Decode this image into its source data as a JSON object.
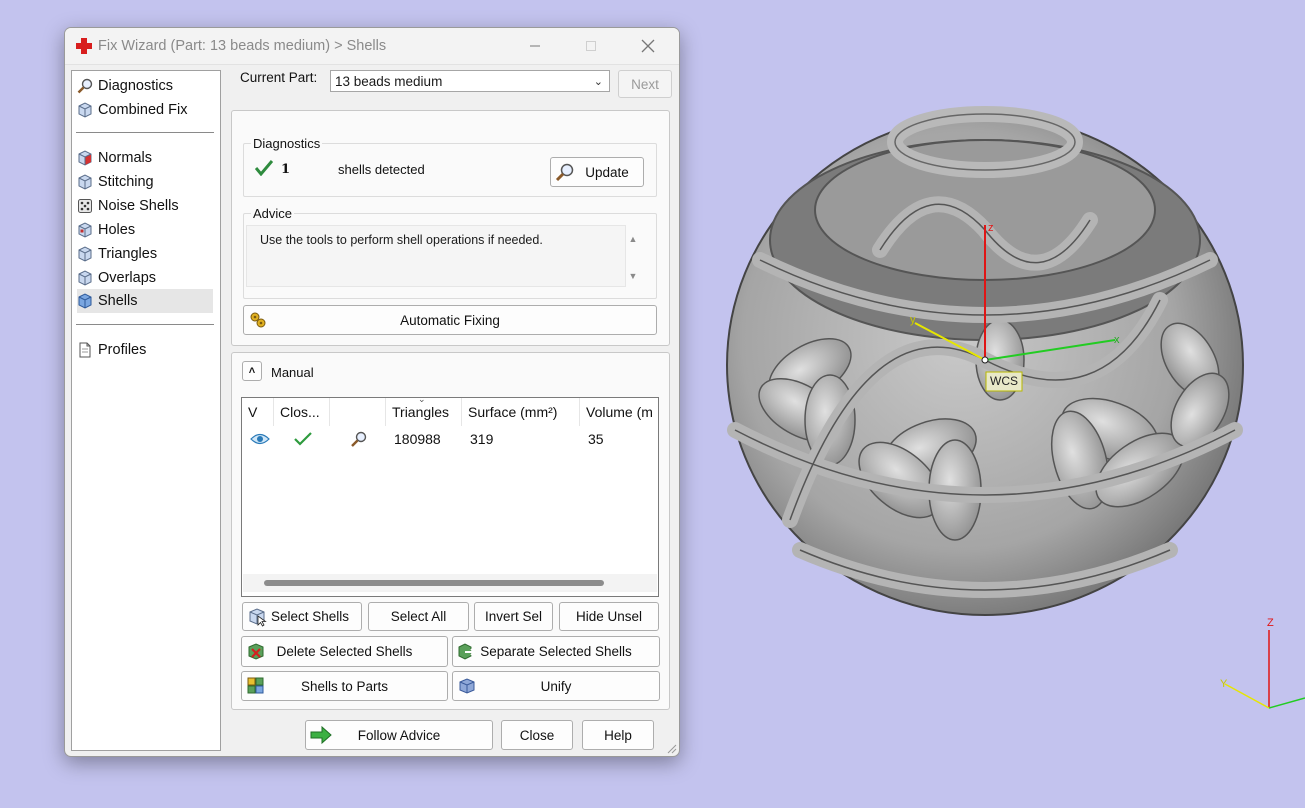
{
  "window": {
    "title": "Fix Wizard (Part: 13 beads medium) > Shells"
  },
  "nav": {
    "items": [
      {
        "label": "Diagnostics",
        "icon": "magnifier-icon"
      },
      {
        "label": "Combined Fix",
        "icon": "cube-icon"
      },
      {
        "label": "Normals",
        "icon": "cube-red-icon"
      },
      {
        "label": "Stitching",
        "icon": "cube-icon"
      },
      {
        "label": "Noise Shells",
        "icon": "dice-icon"
      },
      {
        "label": "Holes",
        "icon": "cube-icon"
      },
      {
        "label": "Triangles",
        "icon": "cube-icon"
      },
      {
        "label": "Overlaps",
        "icon": "cube-icon"
      },
      {
        "label": "Shells",
        "icon": "cube-blue-icon"
      },
      {
        "label": "Profiles",
        "icon": "document-icon"
      }
    ],
    "selected": "Shells"
  },
  "current_part": {
    "label": "Current Part:",
    "value": "13 beads medium",
    "next_label": "Next"
  },
  "diagnostics": {
    "title": "Diagnostics",
    "count": "1",
    "text": "shells detected",
    "update_label": "Update"
  },
  "advice": {
    "title": "Advice",
    "text": "Use the tools to perform shell operations if needed."
  },
  "automatic_fixing_label": "Automatic Fixing",
  "manual": {
    "title": "Manual",
    "columns": [
      "V",
      "Clos...",
      "",
      "Triangles",
      "Surface (mm²)",
      "Volume (m"
    ],
    "rows": [
      {
        "triangles": "180988",
        "surface": "319",
        "volume": "35"
      }
    ]
  },
  "actions": {
    "select_shells": "Select Shells",
    "select_all": "Select All",
    "invert_sel": "Invert Sel",
    "hide_unsel": "Hide Unsel",
    "delete_selected": "Delete Selected Shells",
    "separate_selected": "Separate Selected Shells",
    "shells_to_parts": "Shells to Parts",
    "unify": "Unify"
  },
  "footer": {
    "follow_advice": "Follow Advice",
    "close": "Close",
    "help": "Help"
  },
  "viewport": {
    "wcs_label": "WCS",
    "axis_x": "x",
    "axis_y": "y",
    "axis_z": "z",
    "corner_z": "Z",
    "corner_y": "Y",
    "background_color": "#c3c3ee"
  }
}
